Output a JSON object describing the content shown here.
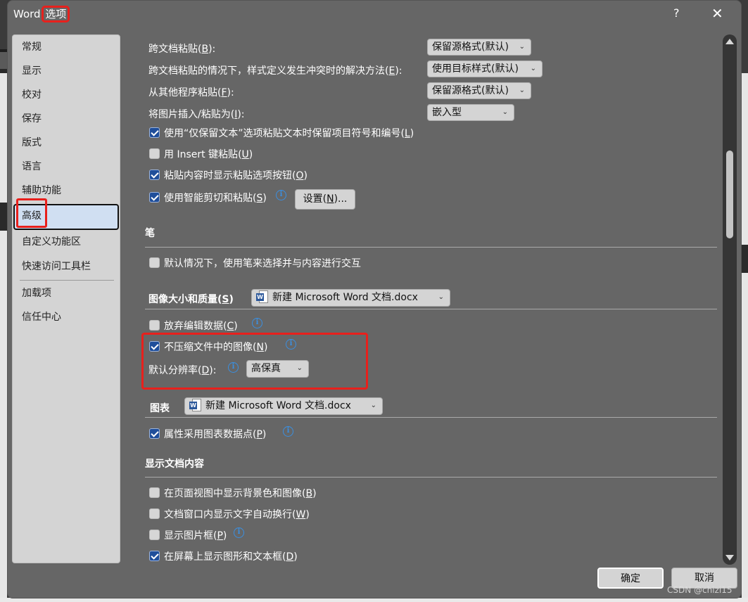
{
  "dialog": {
    "title_app": "Word",
    "title_highlight": "选项",
    "help_label": "?",
    "close_label": "✕"
  },
  "sidebar": {
    "items": [
      {
        "label": "常规"
      },
      {
        "label": "显示"
      },
      {
        "label": "校对"
      },
      {
        "label": "保存"
      },
      {
        "label": "版式"
      },
      {
        "label": "语言"
      },
      {
        "label": "辅助功能"
      },
      {
        "label": "高级",
        "active": true
      },
      {
        "label": "自定义功能区"
      },
      {
        "label": "快速访问工具栏"
      },
      {
        "label": "加载项"
      },
      {
        "label": "信任中心"
      }
    ]
  },
  "paste": {
    "cross_doc": {
      "label": "跨文档粘贴",
      "key": "B",
      "value": "保留源格式(默认)"
    },
    "cross_doc_conflict": {
      "label": "跨文档粘贴的情况下，样式定义发生冲突时的解决方法",
      "key": "E",
      "value": "使用目标样式(默认)"
    },
    "other_program": {
      "label": "从其他程序粘贴",
      "key": "F",
      "value": "保留源格式(默认)"
    },
    "insert_picture": {
      "label": "将图片插入/粘贴为",
      "key": "I",
      "value": "嵌入型"
    },
    "keep_bullets": {
      "label": "使用“仅保留文本”选项粘贴文本时保留项目符号和编号",
      "key": "L",
      "checked": true
    },
    "insert_key": {
      "label": "用 Insert 键粘贴",
      "key": "U",
      "checked": false
    },
    "show_paste_btn": {
      "label": "粘贴内容时显示粘贴选项按钮",
      "key": "O",
      "checked": true
    },
    "smart_cut": {
      "label": "使用智能剪切和粘贴",
      "key": "S",
      "checked": true
    },
    "settings_button": {
      "label": "设置",
      "key": "N",
      "suffix": "..."
    }
  },
  "pen": {
    "heading": "笔",
    "use_pen": {
      "label": "默认情况下，使用笔来选择并与内容进行交互",
      "checked": false
    }
  },
  "image_quality": {
    "heading": "图像大小和质量",
    "key": "S",
    "document": "新建 Microsoft Word 文档.docx",
    "discard_edit": {
      "label": "放弃编辑数据",
      "key": "C",
      "checked": false
    },
    "no_compress": {
      "label": "不压缩文件中的图像",
      "key": "N",
      "checked": true
    },
    "resolution": {
      "label": "默认分辨率",
      "key": "D",
      "value": "高保真"
    }
  },
  "chart": {
    "heading": "图表",
    "document": "新建 Microsoft Word 文档.docx",
    "props_follow": {
      "label": "属性采用图表数据点",
      "key": "P",
      "checked": true
    }
  },
  "display": {
    "heading": "显示文档内容",
    "bg_colors": {
      "label": "在页面视图中显示背景色和图像",
      "key": "B",
      "checked": false
    },
    "wrap": {
      "label": "文档窗口内显示文字自动换行",
      "key": "W",
      "checked": false
    },
    "picture_placeholders": {
      "label": "显示图片框",
      "key": "P",
      "checked": false
    },
    "drawings": {
      "label": "在屏幕上显示图形和文本框",
      "key": "D",
      "checked": true
    }
  },
  "footer": {
    "ok_label": "确定",
    "cancel_label": "取消",
    "watermark": "CSDN @chizi15"
  },
  "colors": {
    "highlight_red": "#e8201c",
    "checkbox_blue": "#1f4e9a",
    "info_blue": "#3b8fe0",
    "dialog_bg": "#666666"
  }
}
